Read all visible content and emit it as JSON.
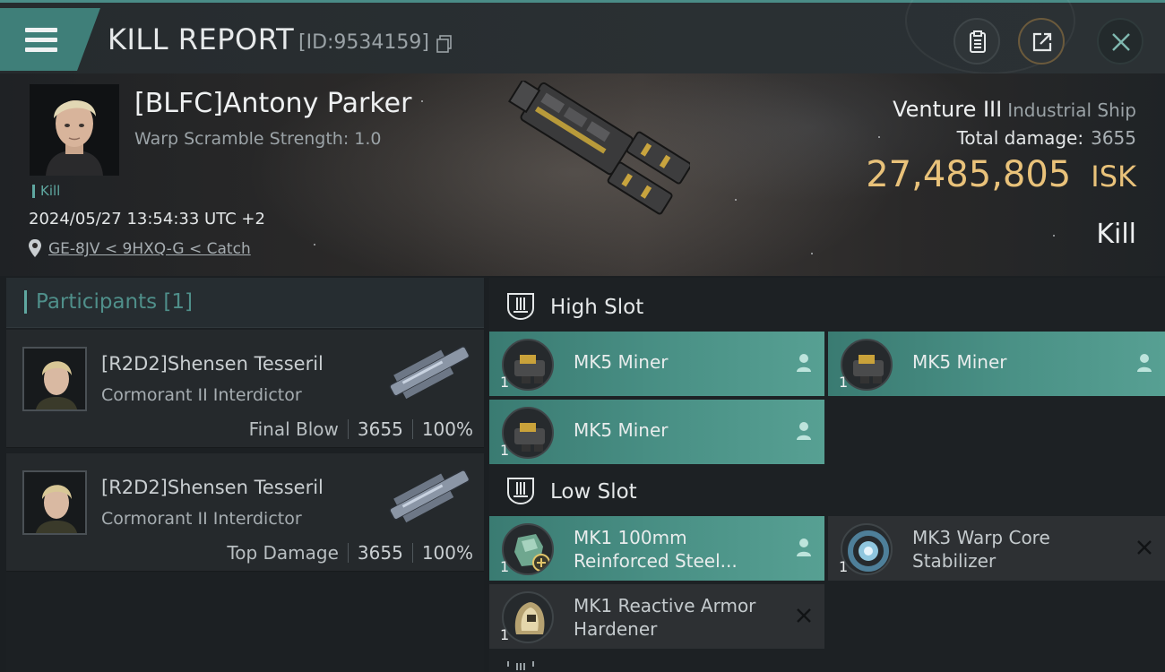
{
  "header": {
    "title": "KILL REPORT",
    "report_id": "[ID:9534159]",
    "icons": {
      "menu": "hamburger-menu-icon",
      "copy": "copy-icon",
      "clipboard": "clipboard-icon",
      "share": "share-icon",
      "close": "close-icon"
    }
  },
  "victim": {
    "name": "[BLFC]Antony Parker",
    "warp_scramble": "Warp Scramble Strength: 1.0",
    "tag": "Kill",
    "datetime": "2024/05/27 13:54:33 UTC +2",
    "location": "GE-8JV < 9HXQ-G < Catch",
    "ship": "Venture III",
    "ship_class": "Industrial Ship",
    "total_damage_label": "Total damage:",
    "total_damage": "3655",
    "isk_value": "27,485,805",
    "isk_unit": "ISK",
    "result": "Kill"
  },
  "participants": {
    "title": "Participants [1]",
    "rows": [
      {
        "name": "[R2D2]Shensen Tesseril",
        "ship": "Cormorant II Interdictor",
        "label": "Final Blow",
        "damage": "3655",
        "percent": "100%"
      },
      {
        "name": "[R2D2]Shensen Tesseril",
        "ship": "Cormorant II Interdictor",
        "label": "Top Damage",
        "damage": "3655",
        "percent": "100%"
      }
    ]
  },
  "slots": {
    "high": {
      "title": "High Slot",
      "modules": [
        {
          "name": "MK5 Miner",
          "qty": "1",
          "status": "pilot-icon"
        },
        {
          "name": "MK5 Miner",
          "qty": "1",
          "status": "pilot-icon"
        },
        {
          "name": "MK5 Miner",
          "qty": "1",
          "status": "pilot-icon"
        }
      ]
    },
    "low": {
      "title": "Low Slot",
      "modules": [
        {
          "name_line1": "MK1 100mm",
          "name_line2": "Reinforced Steel...",
          "qty": "1",
          "status": "pilot-icon"
        },
        {
          "name_line1": "MK3 Warp Core",
          "name_line2": "Stabilizer",
          "qty": "1",
          "status": "destroyed-x-icon"
        },
        {
          "name_line1": "MK1 Reactive Armor",
          "name_line2": "Hardener",
          "qty": "1",
          "status": "destroyed-x-icon"
        }
      ]
    }
  },
  "colors": {
    "accent_teal": "#4a9186",
    "isk_gold": "#e9c27a",
    "panel_dark": "#1c2023"
  }
}
